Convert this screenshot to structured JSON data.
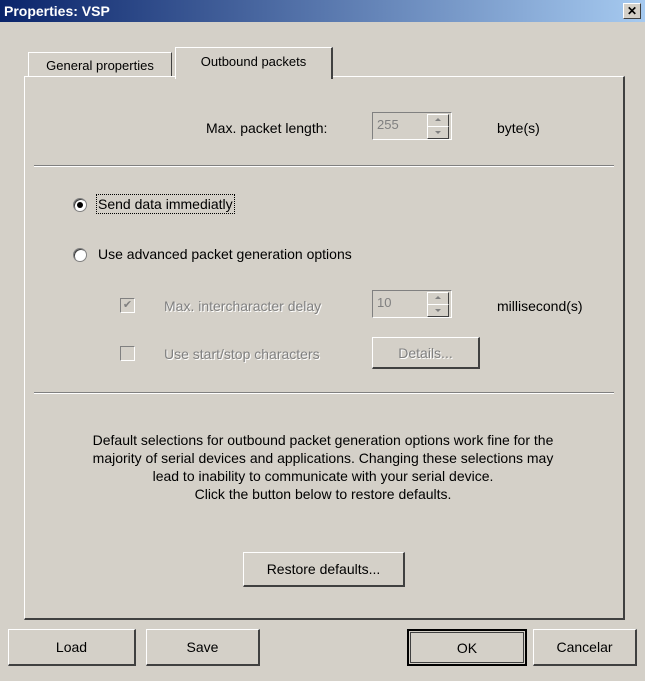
{
  "window": {
    "title": "Properties: VSP",
    "close_glyph": "✕"
  },
  "tabs": [
    {
      "label": "General properties",
      "active": false
    },
    {
      "label": "Outbound packets",
      "active": true
    }
  ],
  "packet_length": {
    "label": "Max. packet length:",
    "value": "255",
    "unit": "byte(s)"
  },
  "options": {
    "send_immediately": {
      "label": "Send data immediatly",
      "selected": true
    },
    "advanced": {
      "label": "Use advanced packet generation options",
      "selected": false
    },
    "intercharacter": {
      "label": "Max. intercharacter delay",
      "checked": true,
      "value": "10",
      "unit": "millisecond(s)"
    },
    "start_stop": {
      "label": "Use start/stop characters",
      "checked": false,
      "details_label": "Details..."
    }
  },
  "info_lines": [
    "Default selections for outbound packet generation options work fine for the",
    "majority of serial devices and applications. Changing these selections may",
    "lead to inability to communicate with your serial device.",
    "Click the button below to restore defaults."
  ],
  "restore_label": "Restore defaults...",
  "footer": {
    "load": "Load",
    "save": "Save",
    "ok": "OK",
    "cancel": "Cancelar"
  },
  "colors": {
    "face": "#d4d0c8",
    "title_start": "#0a246a",
    "title_end": "#a6caf0",
    "disabled_text": "#808080"
  }
}
